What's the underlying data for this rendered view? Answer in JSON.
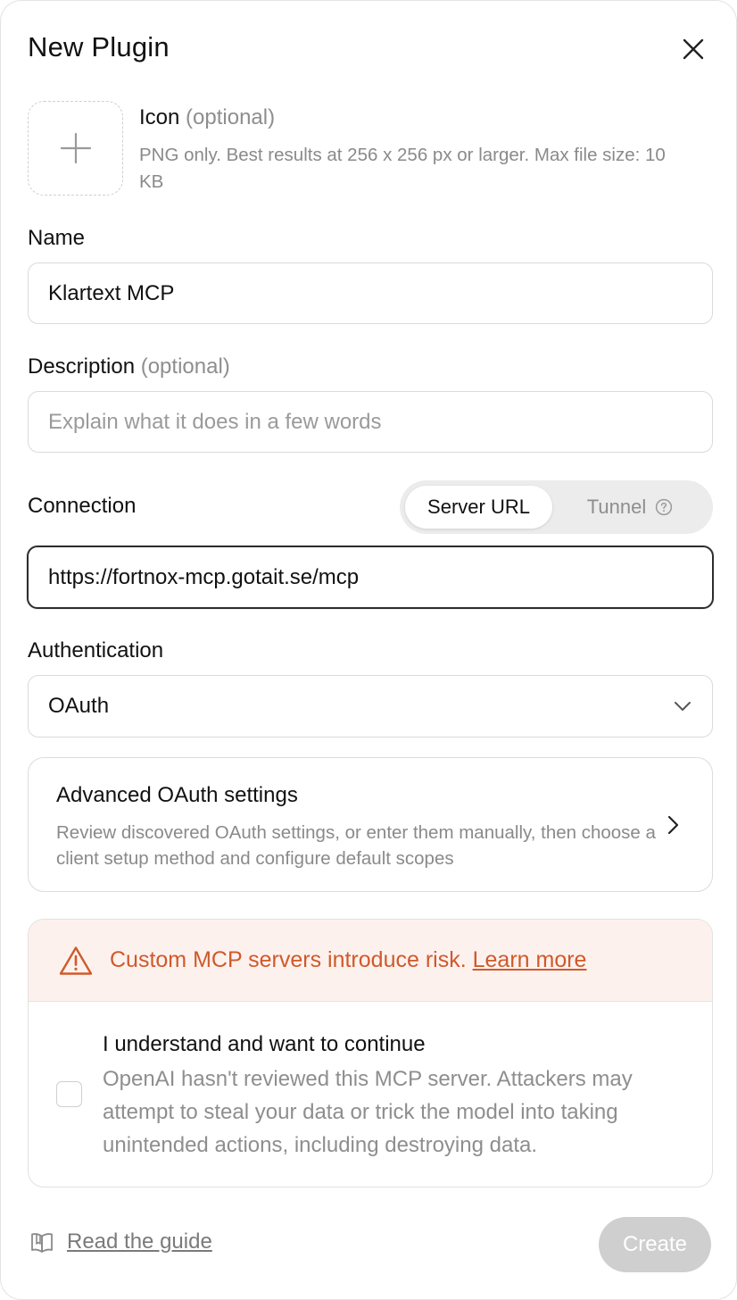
{
  "modal": {
    "title": "New Plugin"
  },
  "icon_upload": {
    "title": "Icon",
    "optional": "(optional)",
    "help": "PNG only. Best results at 256 x 256 px or larger. Max file size: 10 KB"
  },
  "name": {
    "label": "Name",
    "value": "Klartext MCP"
  },
  "description": {
    "label": "Description",
    "optional": "(optional)",
    "value": "",
    "placeholder": "Explain what it does in a few words"
  },
  "connection": {
    "label": "Connection",
    "options": [
      "Server URL",
      "Tunnel"
    ],
    "selected": "Server URL",
    "url": "https://fortnox-mcp.gotait.se/mcp"
  },
  "authentication": {
    "label": "Authentication",
    "selected": "OAuth"
  },
  "advanced_oauth": {
    "title": "Advanced OAuth settings",
    "description": "Review discovered OAuth settings, or enter them manually, then choose a client setup method and configure default scopes"
  },
  "risk": {
    "message": "Custom MCP servers introduce risk.",
    "link": "Learn more",
    "color": "#cf5a2a",
    "acknowledge_title": "I understand and want to continue",
    "acknowledge_description": "OpenAI hasn't reviewed this MCP server. Attackers may attempt to steal your data or trick the model into taking unintended actions, including destroying data.",
    "acknowledged": false
  },
  "footer": {
    "guide_link": "Read the guide",
    "create_label": "Create"
  },
  "icons": {
    "close": "close-icon",
    "add": "plus-icon",
    "help": "help-circle-icon",
    "dropdown": "chevron-down-icon",
    "advanced": "chevron-right-icon",
    "warning": "warning-triangle-icon",
    "guide": "book-icon"
  }
}
